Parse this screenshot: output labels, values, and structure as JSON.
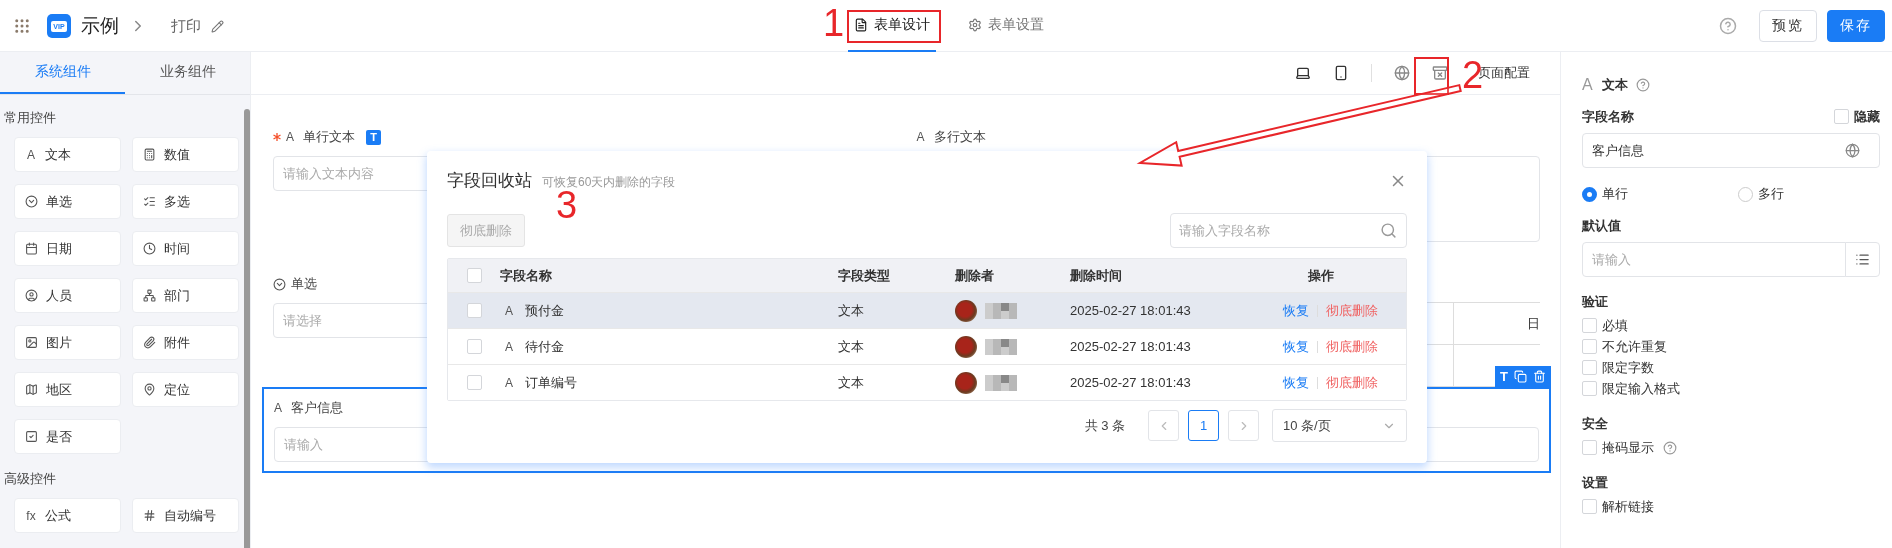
{
  "header": {
    "logo": "VIP",
    "app_name": "示例",
    "breadcrumb": "打印"
  },
  "mode_tabs": [
    {
      "label": "表单设计",
      "selected": true
    },
    {
      "label": "表单设置",
      "selected": false
    }
  ],
  "header_buttons": [
    {
      "label": "预览",
      "kind": "default"
    },
    {
      "label": "保存",
      "kind": "primary"
    }
  ],
  "sidebar": {
    "tabs": [
      {
        "label": "系统组件",
        "selected": true
      },
      {
        "label": "业务组件",
        "selected": false
      }
    ],
    "sections": [
      {
        "title": "常用控件",
        "items": [
          {
            "label": "文本",
            "kind": "text",
            "glyph": "A"
          },
          {
            "label": "数值",
            "kind": "number"
          },
          {
            "label": "单选",
            "kind": "radio"
          },
          {
            "label": "多选",
            "kind": "multi"
          },
          {
            "label": "日期",
            "kind": "date"
          },
          {
            "label": "时间",
            "kind": "time"
          },
          {
            "label": "人员",
            "kind": "user"
          },
          {
            "label": "部门",
            "kind": "dept"
          },
          {
            "label": "图片",
            "kind": "image"
          },
          {
            "label": "附件",
            "kind": "attach"
          },
          {
            "label": "地区",
            "kind": "region"
          },
          {
            "label": "定位",
            "kind": "location"
          },
          {
            "label": "是否",
            "kind": "bool"
          }
        ]
      },
      {
        "title": "高级控件",
        "items": [
          {
            "label": "公式",
            "kind": "formula",
            "glyph": "fx"
          },
          {
            "label": "自动编号",
            "kind": "serial"
          }
        ]
      }
    ]
  },
  "canvas_toolbar": {
    "label": "页面配置"
  },
  "form": {
    "fields": [
      {
        "kind": "text",
        "glyph": "A",
        "label": "单行文本",
        "required": true,
        "badge": "T",
        "placeholder": "请输入文本内容",
        "selected": false
      },
      {
        "kind": "textarea",
        "glyph": "A",
        "label": "多行文本",
        "required": false,
        "selected": false
      },
      {
        "kind": "select",
        "label": "单选",
        "required": false,
        "placeholder": "请选择",
        "selected": false
      },
      {
        "kind": "table",
        "header_text": "日",
        "selected": false
      },
      {
        "kind": "text",
        "glyph": "A",
        "label": "客户信息",
        "required": false,
        "placeholder": "请输入",
        "selected": true,
        "badge": "T"
      }
    ]
  },
  "dialog": {
    "title": "字段回收站",
    "subtitle": "可恢复60天内删除的字段",
    "bulk_button": {
      "label": "彻底删除",
      "disabled": true
    },
    "search_placeholder": "请输入字段名称",
    "columns": [
      "字段名称",
      "字段类型",
      "删除者",
      "删除时间",
      "操作"
    ],
    "all_checked": false,
    "rows": [
      {
        "glyph": "A",
        "name": "预付金",
        "type": "文本",
        "deleter_redacted": true,
        "time": "2025-02-27 18:01:43",
        "checked": false,
        "hovered": true,
        "actions": [
          {
            "label": "恢复",
            "kind": "restore"
          },
          {
            "label": "彻底删除",
            "kind": "delete"
          }
        ]
      },
      {
        "glyph": "A",
        "name": "待付金",
        "type": "文本",
        "deleter_redacted": true,
        "time": "2025-02-27 18:01:43",
        "checked": false,
        "hovered": false,
        "actions": [
          {
            "label": "恢复",
            "kind": "restore"
          },
          {
            "label": "彻底删除",
            "kind": "delete"
          }
        ]
      },
      {
        "glyph": "A",
        "name": "订单编号",
        "type": "文本",
        "deleter_redacted": true,
        "time": "2025-02-27 18:01:43",
        "checked": false,
        "hovered": false,
        "actions": [
          {
            "label": "恢复",
            "kind": "restore"
          },
          {
            "label": "彻底删除",
            "kind": "delete"
          }
        ]
      }
    ],
    "total": "共 3 条",
    "pages": [
      {
        "label": "1",
        "selected": true
      }
    ],
    "page_size": "10 条/页"
  },
  "properties": {
    "glyph": "A",
    "title": "文本",
    "name_label": "字段名称",
    "hide": {
      "label": "隐藏",
      "checked": false
    },
    "name_value": "客户信息",
    "line_modes": [
      {
        "label": "单行",
        "selected": true
      },
      {
        "label": "多行",
        "selected": false
      }
    ],
    "default_label": "默认值",
    "default_placeholder": "请输入",
    "groups": [
      {
        "title": "验证",
        "options": [
          {
            "label": "必填",
            "checked": false,
            "help": false
          },
          {
            "label": "不允许重复",
            "checked": false,
            "help": false
          },
          {
            "label": "限定字数",
            "checked": false,
            "help": false
          },
          {
            "label": "限定输入格式",
            "checked": false,
            "help": false
          }
        ]
      },
      {
        "title": "安全",
        "options": [
          {
            "label": "掩码显示",
            "checked": false,
            "help": true
          }
        ]
      },
      {
        "title": "设置",
        "options": [
          {
            "label": "解析链接",
            "checked": false,
            "help": false
          }
        ]
      }
    ]
  },
  "annotations": [
    {
      "label": "1"
    },
    {
      "label": "2"
    },
    {
      "label": "3"
    }
  ]
}
